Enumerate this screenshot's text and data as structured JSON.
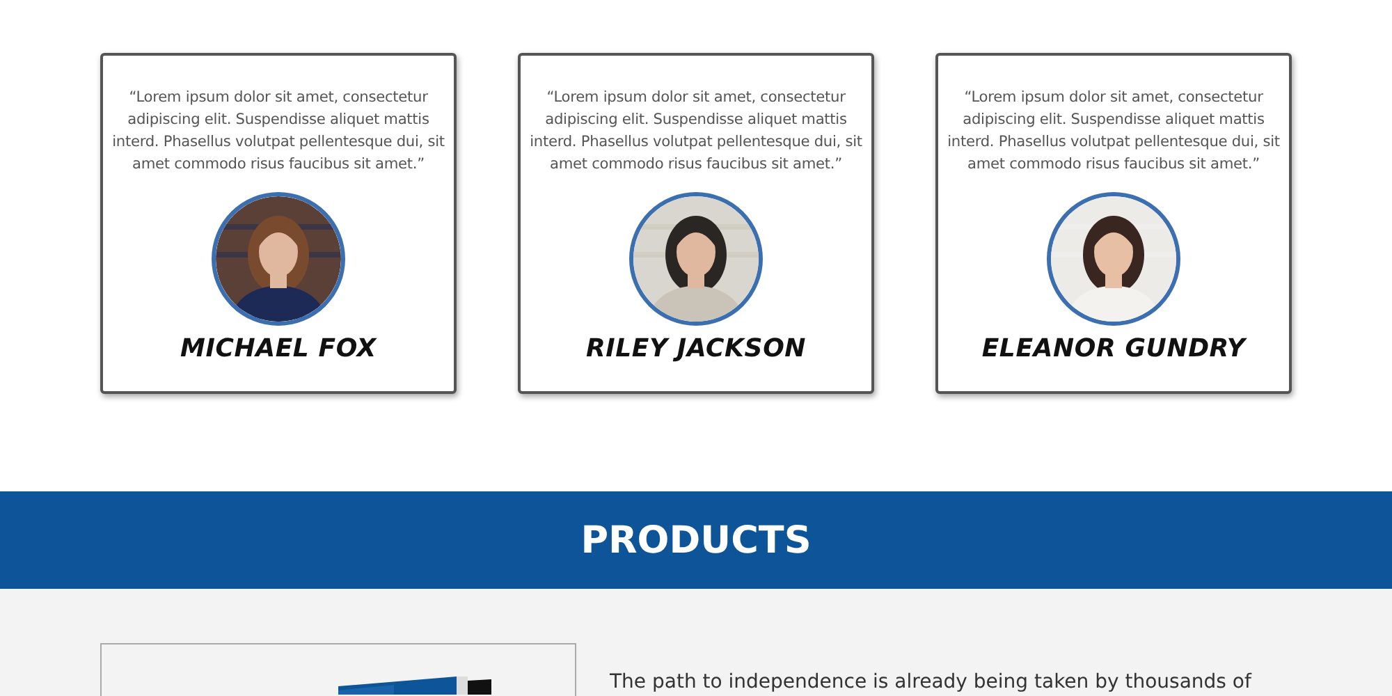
{
  "testimonials": [
    {
      "quote": "“Lorem ipsum dolor sit amet, consectetur adipiscing elit. Suspendisse aliquet mattis interd. Phasellus volutpat pellentesque dui, sit amet commodo risus faucibus sit amet.”",
      "name": "MICHAEL FOX"
    },
    {
      "quote": "“Lorem ipsum dolor sit amet, consectetur adipiscing elit. Suspendisse aliquet mattis interd. Phasellus volutpat pellentesque dui, sit amet commodo risus faucibus sit amet.”",
      "name": "RILEY JACKSON"
    },
    {
      "quote": "“Lorem ipsum dolor sit amet, consectetur adipiscing elit. Suspendisse aliquet mattis interd. Phasellus volutpat pellentesque dui, sit amet commodo risus faucibus sit amet.”",
      "name": "ELEANOR GUNDRY"
    }
  ],
  "products": {
    "heading": "PRODUCTS",
    "text": "The path to independence is already being taken by thousands of"
  }
}
